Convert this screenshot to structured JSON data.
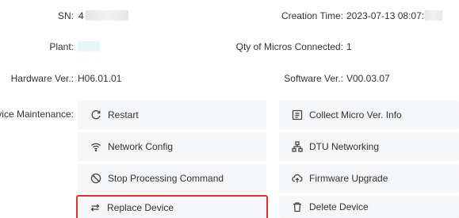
{
  "info": {
    "sn_label": "SN:",
    "sn_value": "4",
    "creation_label": "Creation Time:",
    "creation_value": "2023-07-13 08:07:33",
    "plant_label": "Plant:",
    "micros_label": "Qty of Micros Connected:",
    "micros_value": "1",
    "hardware_label": "Hardware Ver.:",
    "hardware_value": "H06.01.01",
    "software_label": "Software Ver.:",
    "software_value": "V00.03.07"
  },
  "maintenance": {
    "label": "Device Maintenance:",
    "buttons": [
      {
        "label": "Restart",
        "icon": "restart-icon"
      },
      {
        "label": "Collect Micro Ver. Info",
        "icon": "info-list-icon"
      },
      {
        "label": "Network Config",
        "icon": "wifi-icon"
      },
      {
        "label": "DTU Networking",
        "icon": "network-tree-icon"
      },
      {
        "label": "Stop Processing Command",
        "icon": "stop-icon"
      },
      {
        "label": "Firmware Upgrade",
        "icon": "cloud-upload-icon"
      },
      {
        "label": "Replace Device",
        "icon": "swap-icon"
      },
      {
        "label": "Delete Device",
        "icon": "trash-icon"
      }
    ]
  },
  "colors": {
    "button_bg": "#f5f6f8",
    "selected_outline": "#e0322b"
  }
}
